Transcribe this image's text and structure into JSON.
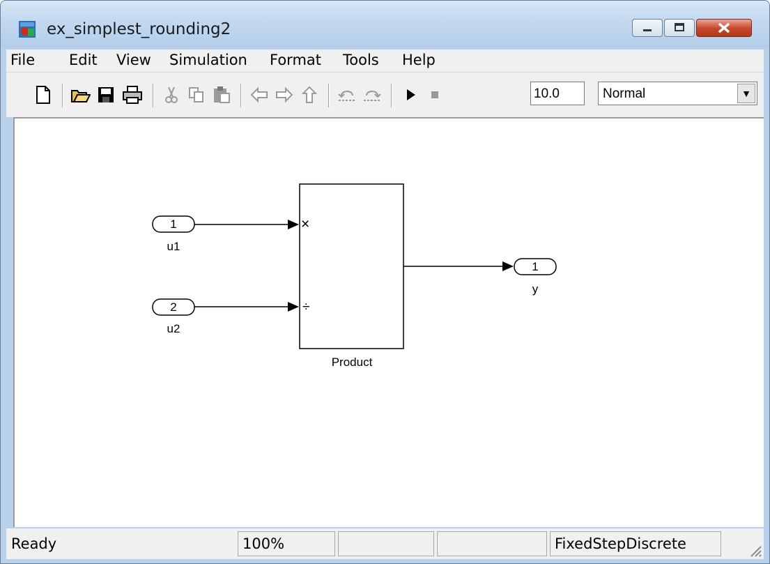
{
  "window": {
    "title": "ex_simplest_rounding2"
  },
  "menu": [
    "File",
    "Edit",
    "View",
    "Simulation",
    "Format",
    "Tools",
    "Help"
  ],
  "toolbar": {
    "stop_time": "10.0",
    "sim_mode": "Normal",
    "icons": [
      "new-icon",
      "open-icon",
      "save-icon",
      "print-icon",
      "cut-icon",
      "copy-icon",
      "paste-icon",
      "back-icon",
      "forward-icon",
      "up-icon",
      "undo-icon",
      "redo-icon",
      "play-icon",
      "stop-icon"
    ]
  },
  "diagram": {
    "inport1": {
      "number": "1",
      "label": "u1"
    },
    "inport2": {
      "number": "2",
      "label": "u2"
    },
    "product": {
      "label": "Product",
      "sign1": "×",
      "sign2": "÷"
    },
    "outport": {
      "number": "1",
      "label": "y"
    }
  },
  "status": {
    "state": "Ready",
    "zoom": "100%",
    "field3": "",
    "field4": "",
    "solver": "FixedStepDiscrete"
  },
  "colors": {
    "titlebar": "#c2d8ef",
    "close_button": "#c7452b",
    "chrome": "#f0f0f0"
  }
}
